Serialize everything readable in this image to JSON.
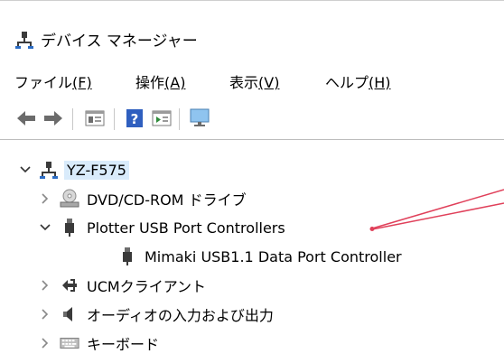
{
  "window": {
    "title": "デバイス マネージャー"
  },
  "menu": [
    {
      "label": "ファイル",
      "key": "(F)"
    },
    {
      "label": "操作",
      "key": "(A)"
    },
    {
      "label": "表示",
      "key": "(V)"
    },
    {
      "label": "ヘルプ",
      "key": "(H)"
    }
  ],
  "toolbar": {
    "buttons": [
      "back-icon",
      "forward-icon",
      "properties-icon",
      "help-icon",
      "update-driver-icon",
      "monitor-icon"
    ]
  },
  "tree": {
    "root": "YZ-F575",
    "items": [
      {
        "label": "DVD/CD-ROM ドライブ",
        "expanded": false
      },
      {
        "label": "Plotter USB Port Controllers",
        "expanded": true
      },
      {
        "label": "Mimaki USB1.1 Data Port Controller",
        "child": true
      },
      {
        "label": "UCMクライアント",
        "expanded": false
      },
      {
        "label": "オーディオの入力および出力",
        "expanded": false
      },
      {
        "label": "キーボード",
        "expanded": false
      }
    ]
  },
  "colors": {
    "annotation": "#e0405a",
    "selection": "#d9ebfb",
    "menuText": "#000000"
  }
}
